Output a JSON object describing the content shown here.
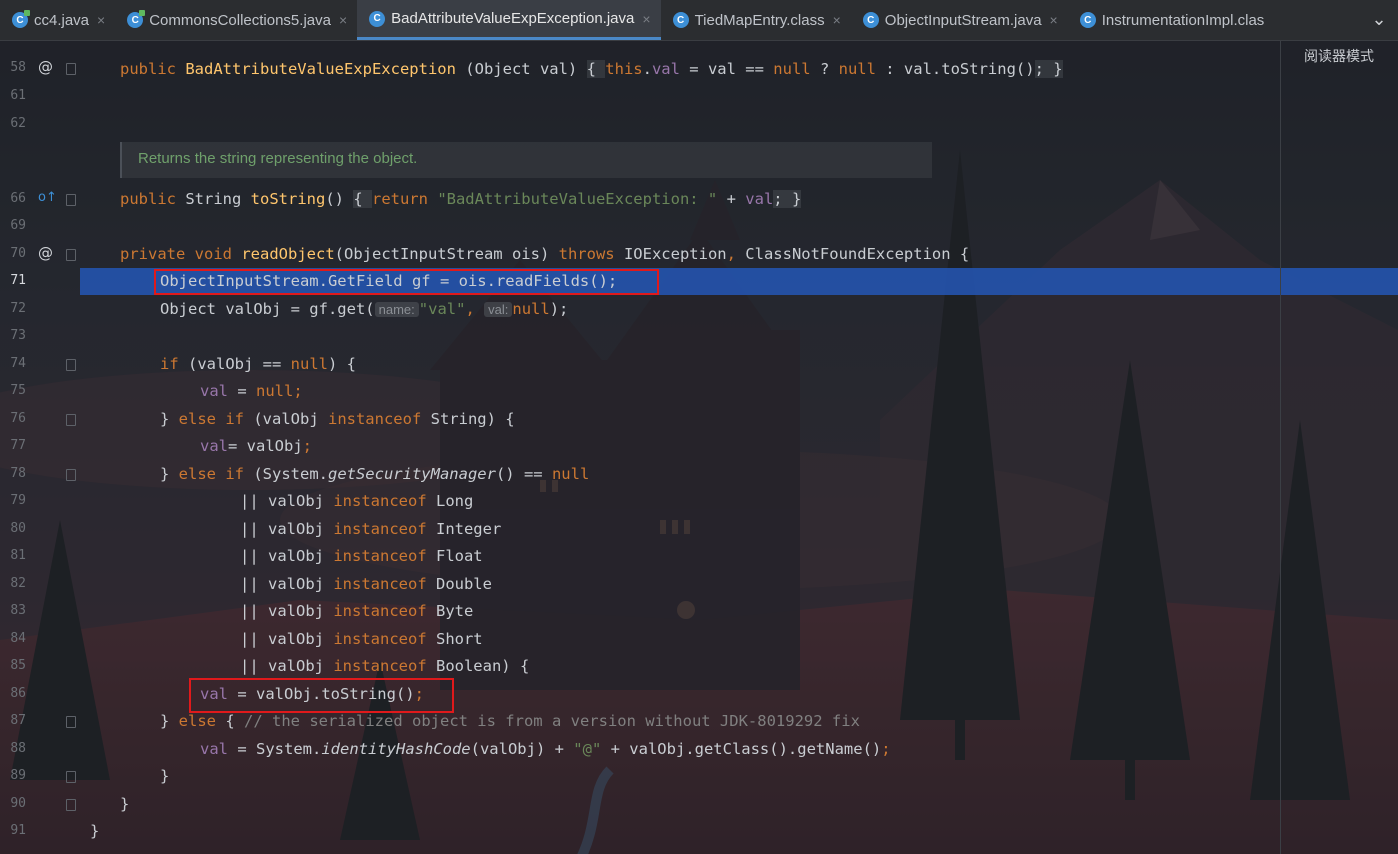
{
  "tabs": [
    {
      "label": "cc4.java",
      "icon": "java-class-icon",
      "active": false
    },
    {
      "label": "CommonsCollections5.java",
      "icon": "java-class-icon",
      "active": false
    },
    {
      "label": "BadAttributeValueExpException.java",
      "icon": "class-icon",
      "active": true
    },
    {
      "label": "TiedMapEntry.class",
      "icon": "class-icon",
      "active": false
    },
    {
      "label": "ObjectInputStream.java",
      "icon": "class-icon",
      "active": false
    },
    {
      "label": "InstrumentationImpl.clas",
      "icon": "class-icon",
      "active": false
    }
  ],
  "reader_mode_label": "阅读器模式",
  "tab_menu_symbol": "⌄",
  "doc_comment": "Returns the string representing the object.",
  "line_numbers": [
    "58",
    "61",
    "62",
    "66",
    "69",
    "70",
    "71",
    "72",
    "73",
    "74",
    "75",
    "76",
    "77",
    "78",
    "79",
    "80",
    "81",
    "82",
    "83",
    "84",
    "85",
    "86",
    "87",
    "88",
    "89",
    "90",
    "91"
  ],
  "current_line": "71",
  "hints": {
    "name": "name:",
    "val": "val:"
  },
  "code": {
    "l58_a": "public ",
    "l58_b": "BadAttributeValueExpException",
    "l58_c": " (Object val) ",
    "l58_d": "{ ",
    "l58_e": "this",
    "l58_f": ".",
    "l58_g": "val",
    "l58_h": " = val == ",
    "l58_i": "null",
    "l58_j": " ? ",
    "l58_k": "null",
    "l58_l": " : val.toString()",
    "l58_m": "; }",
    "l66_a": "public ",
    "l66_b": "String ",
    "l66_c": "toString",
    "l66_d": "() ",
    "l66_e": "{ ",
    "l66_f": "return ",
    "l66_g": "\"BadAttributeValueException: \"",
    "l66_h": " + ",
    "l66_i": "val",
    "l66_j": "; }",
    "l70_a": "private void ",
    "l70_b": "readObject",
    "l70_c": "(ObjectInputStream ois) ",
    "l70_d": "throws ",
    "l70_e": "IOException",
    "l70_f": ", ",
    "l70_g": "ClassNotFoundException {",
    "l71": "ObjectInputStream.GetField gf = ois.readFields();",
    "l72_a": "Object valObj = gf.get(",
    "l72_b": "\"val\"",
    "l72_c": ", ",
    "l72_d": "null",
    "l72_e": ");",
    "l74_a": "if ",
    "l74_b": "(valObj == ",
    "l74_c": "null",
    "l74_d": ") {",
    "l75_a": "val",
    "l75_b": " = ",
    "l75_c": "null",
    "l75_d": ";",
    "l76_a": "} ",
    "l76_b": "else if ",
    "l76_c": "(valObj ",
    "l76_d": "instanceof ",
    "l76_e": "String) {",
    "l77_a": "val",
    "l77_b": "= valObj",
    "l77_c": ";",
    "l78_a": "} ",
    "l78_b": "else if ",
    "l78_c": "(System.",
    "l78_d": "getSecurityManager",
    "l78_e": "() == ",
    "l78_f": "null",
    "l79": "Long",
    "l80": "Integer",
    "l81": "Float",
    "l82": "Double",
    "l83": "Byte",
    "l84": "Short",
    "l85": "Boolean) {",
    "or_prefix": "|| valObj ",
    "instanceof_kw": "instanceof ",
    "l86_a": "val",
    "l86_b": " = valObj.toString()",
    "l86_c": ";",
    "l87_a": "} ",
    "l87_b": "else ",
    "l87_c": "{ ",
    "l87_d": "// the serialized object is from a version without JDK-8019292 fix",
    "l88_a": "val",
    "l88_b": " = System.",
    "l88_c": "identityHashCode",
    "l88_d": "(valObj) + ",
    "l88_e": "\"@\"",
    "l88_f": " + valObj.getClass().getName()",
    "l88_g": ";",
    "l89": "}",
    "l90": "}",
    "l91": "}"
  },
  "colors": {
    "keyword": "#cc7832",
    "method": "#ffc66d",
    "field": "#9876aa",
    "string": "#6a8759",
    "comment": "#808080",
    "selection": "#2451a8",
    "annotation_box": "#e0191b"
  }
}
